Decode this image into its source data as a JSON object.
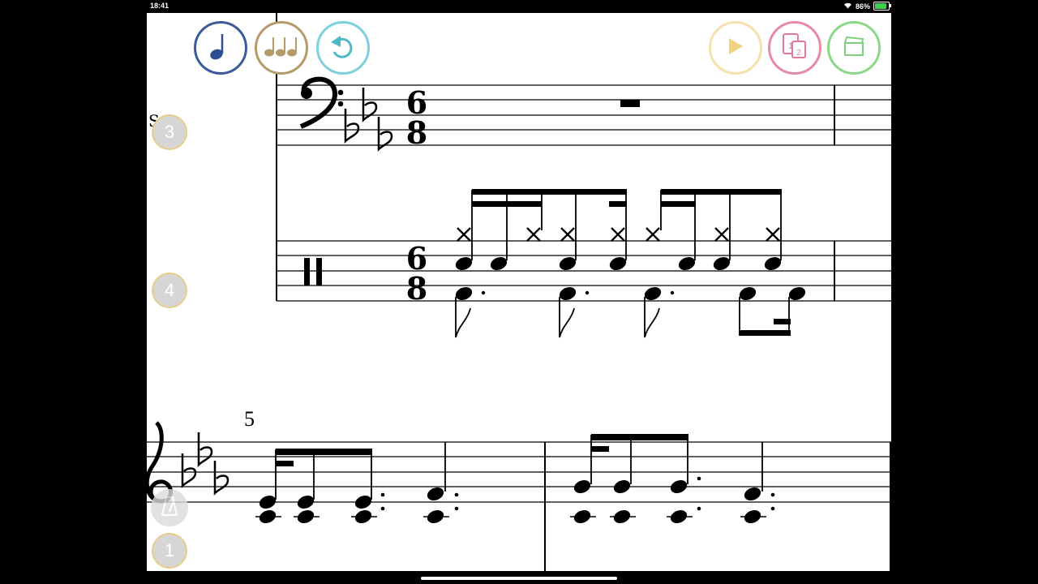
{
  "status_bar": {
    "time": "18:41",
    "battery": "86%",
    "battery_level": 0.86
  },
  "toolbar": {
    "left_buttons": [
      {
        "name": "note-input-button",
        "icon": "quarter-note-icon",
        "color": "#3a5a9a"
      },
      {
        "name": "note-group-button",
        "icon": "eighth-notes-icon",
        "color": "#b59a6a"
      },
      {
        "name": "undo-button",
        "icon": "undo-arrow-icon",
        "color": "#4fb8c8"
      }
    ],
    "right_buttons": [
      {
        "name": "play-button",
        "icon": "play-icon",
        "color": "#f0c96a"
      },
      {
        "name": "pages-button",
        "icon": "pages-icon",
        "color": "#e07a98"
      },
      {
        "name": "clapper-button",
        "icon": "clapperboard-icon",
        "color": "#7fd07a"
      }
    ]
  },
  "side_controls": {
    "staff_buttons": [
      {
        "label": "3"
      },
      {
        "label": "4"
      },
      {
        "label": "1"
      }
    ],
    "metronome_icon": "metronome-icon"
  },
  "score": {
    "system1": {
      "bass_staff": {
        "clef": "bass-clef",
        "key_signature": "3 flats",
        "time_signature": {
          "top": "6",
          "bottom": "8"
        },
        "rest": "whole-rest"
      },
      "drum_staff": {
        "clef": "percussion-clef",
        "time_signature": {
          "top": "6",
          "bottom": "8"
        }
      },
      "partial_label": "S"
    },
    "system2": {
      "measure_number": "5",
      "clef": "treble-clef",
      "key_signature": "3 flats"
    }
  }
}
